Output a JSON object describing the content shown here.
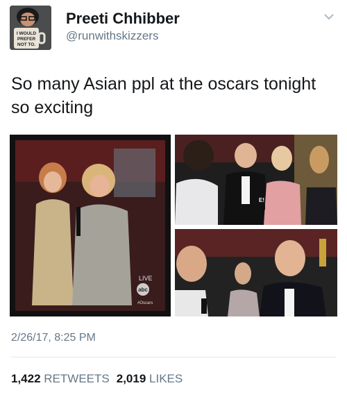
{
  "user": {
    "name": "Preeti Chhibber",
    "handle": "@runwithskizzers",
    "avatar_mug_text": [
      "I WOULD",
      "PREFER",
      "NOT TO."
    ]
  },
  "tweet": {
    "text": "So many Asian ppl at the oscars tonight so exciting",
    "timestamp": "2/26/17, 8:25 PM"
  },
  "media": {
    "tv_logo_top": "LIVE",
    "tv_logo_mid": "abc",
    "tv_logo_bottom": "#Oscars",
    "mic_flag": "E!"
  },
  "stats": {
    "retweets_count": "1,422",
    "retweets_label": "RETWEETS",
    "likes_count": "2,019",
    "likes_label": "LIKES"
  }
}
